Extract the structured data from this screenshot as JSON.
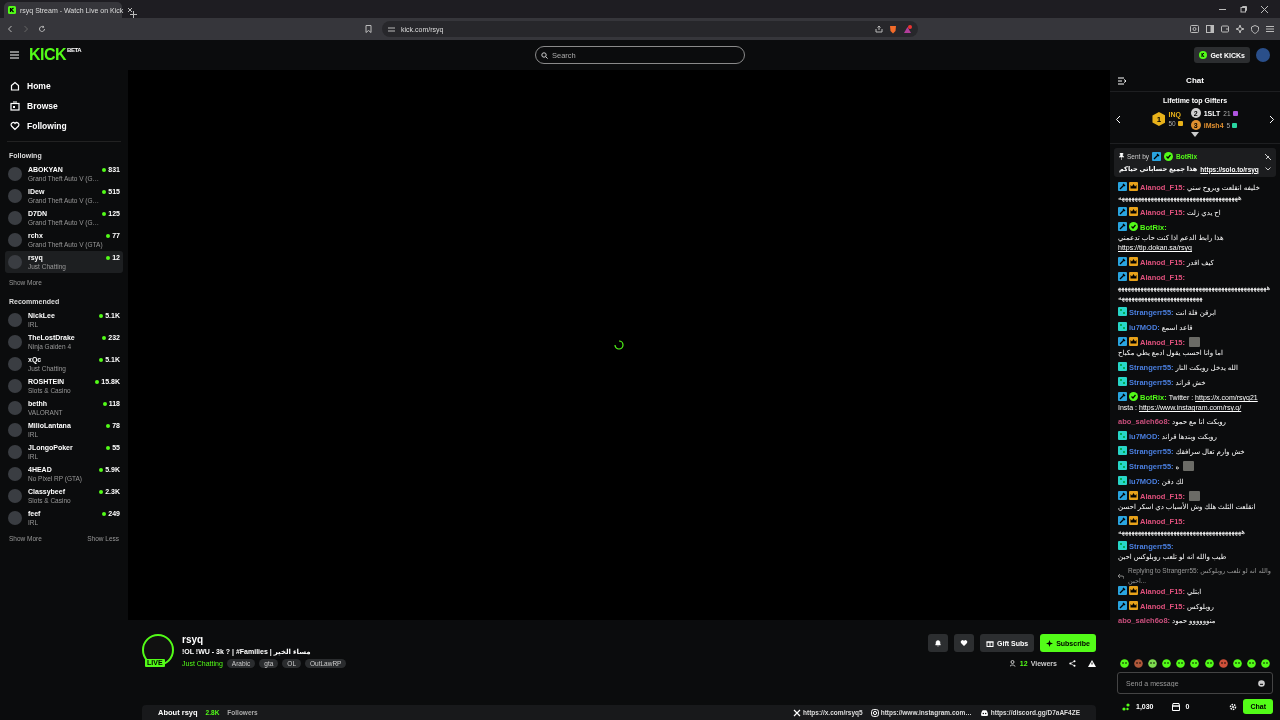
{
  "browser": {
    "tab_title": "rsyq Stream - Watch Live on Kick",
    "url": "kick.com/rsyq"
  },
  "header": {
    "logo": "KICK",
    "logo_badge": "BETA",
    "search": {
      "placeholder": "Search"
    },
    "get_kicks": "Get KICKs"
  },
  "sidebar": {
    "nav": [
      {
        "label": "Home"
      },
      {
        "label": "Browse"
      },
      {
        "label": "Following"
      }
    ],
    "following_title": "Following",
    "following": [
      {
        "name": "ABOKYAN",
        "category": "Grand Theft Auto V (G…",
        "viewers": "831",
        "selected": false
      },
      {
        "name": "lDew",
        "category": "Grand Theft Auto V (G…",
        "viewers": "515",
        "selected": false
      },
      {
        "name": "D7DN",
        "category": "Grand Theft Auto V (G…",
        "viewers": "125",
        "selected": false
      },
      {
        "name": "rchx",
        "category": "Grand Theft Auto V (GTA)",
        "viewers": "77",
        "selected": false
      },
      {
        "name": "rsyq",
        "category": "Just Chatting",
        "viewers": "12",
        "selected": true
      }
    ],
    "following_more": "Show More",
    "recommended_title": "Recommended",
    "recommended": [
      {
        "name": "NickLee",
        "category": "IRL",
        "viewers": "5.1K"
      },
      {
        "name": "TheLostDrake",
        "category": "Ninja Gaiden 4",
        "viewers": "232"
      },
      {
        "name": "xQc",
        "category": "Just Chatting",
        "viewers": "5.1K"
      },
      {
        "name": "ROSHTEIN",
        "category": "Slots & Casino",
        "viewers": "15.8K"
      },
      {
        "name": "bethh",
        "category": "VALORANT",
        "viewers": "118"
      },
      {
        "name": "MilioLantana",
        "category": "IRL",
        "viewers": "78"
      },
      {
        "name": "JLongoPoker",
        "category": "IRL",
        "viewers": "55"
      },
      {
        "name": "4HEAD",
        "category": "No Pixel RP (GTA)",
        "viewers": "5.9K"
      },
      {
        "name": "Classybeef",
        "category": "Slots & Casino",
        "viewers": "2.3K"
      },
      {
        "name": "feef",
        "category": "IRL",
        "viewers": "249"
      }
    ],
    "show_more": "Show More",
    "show_less": "Show Less"
  },
  "stream": {
    "channel": "rsyq",
    "live": "LIVE",
    "title": "!OL !WU - 3k ? | #Families | مساء الخير",
    "category": "Just Chatting",
    "tags": [
      "Arabic",
      "gta",
      "OL",
      "OutLawRP"
    ],
    "gift_subs": "Gift Subs",
    "subscribe": "Subscribe",
    "viewers_count": "12",
    "viewers_label": "Viewers",
    "about": "About rsyq",
    "followers_count": "2.8K",
    "followers_label": "Followers",
    "links": [
      {
        "kind": "x",
        "text": "https://x.com/rsyq5"
      },
      {
        "kind": "instagram",
        "text": "https://www.instagram.com…"
      },
      {
        "kind": "discord",
        "text": "https://discord.gg/D7aAF4ZE"
      }
    ]
  },
  "chat": {
    "title": "Chat",
    "gifters_title": "Lifetime top Gifters",
    "gifters": [
      {
        "rank": "1",
        "name": "INQ",
        "count": "50"
      },
      {
        "rank": "2",
        "name": "1SLT",
        "count": "21"
      },
      {
        "rank": "3",
        "name": "iMsh4",
        "count": "5"
      }
    ],
    "pinned": {
      "sent_by": "Sent by",
      "user": "BotRix",
      "text": "هذا جميع حساباتي حياكم",
      "link": "https://solo.to/rsyq"
    },
    "messages": [
      {
        "user": "Alanod_F15:",
        "color": "#e0517d",
        "kind": "moderator",
        "parts": [
          {
            "kind": "text",
            "text": "خليفه انقلعت ويروح سني"
          },
          {
            "kind": "text",
            "text": "هههههههههههههههههههههههههههههههههههههه"
          }
        ]
      },
      {
        "user": "Alanod_F15:",
        "color": "#e0517d",
        "kind": "moderator",
        "parts": [
          {
            "kind": "text",
            "text": "اح يدي زلت"
          }
        ]
      },
      {
        "user": "BotRix:",
        "color": "#53fc18",
        "kind": "bot",
        "parts": [
          {
            "kind": "text",
            "text": "هذا رابط الدعم اذا كنت حاب تدعمني"
          },
          {
            "kind": "link",
            "text": "https://tip.dokan.sa/rsyq"
          }
        ]
      },
      {
        "user": "Alanod_F15:",
        "color": "#e0517d",
        "kind": "moderator",
        "parts": [
          {
            "kind": "text",
            "text": "كيف اقدر"
          }
        ]
      },
      {
        "user": "Alanod_F15:",
        "color": "#e0517d",
        "kind": "moderator",
        "parts": [
          {
            "kind": "text",
            "text": "ههههههههههههههههههههههههههههههههههههههههههههههههههههههههههههههههههههههههه"
          }
        ]
      },
      {
        "user": "Strangerr55:",
        "color": "#4a7fe0",
        "kind": "subscriber",
        "parts": [
          {
            "kind": "text",
            "text": "ابرقن فلة انت"
          }
        ]
      },
      {
        "user": "iu7MOD:",
        "color": "#4a7fe0",
        "kind": "subscriber",
        "parts": [
          {
            "kind": "text",
            "text": "قاعد اسمع"
          }
        ]
      },
      {
        "user": "Alanod_F15:",
        "color": "#e0517d",
        "kind": "moderator",
        "parts": [
          {
            "kind": "emote"
          },
          {
            "kind": "text",
            "text": "اما وانا احسب يقول ادمع يطي مكباح"
          }
        ]
      },
      {
        "user": "Strangerr55:",
        "color": "#4a7fe0",
        "kind": "subscriber",
        "parts": [
          {
            "kind": "text",
            "text": "الله يدخل روبكت النار"
          }
        ]
      },
      {
        "user": "Strangerr55:",
        "color": "#4a7fe0",
        "kind": "subscriber",
        "parts": [
          {
            "kind": "text",
            "text": "خش قراند"
          }
        ]
      },
      {
        "user": "BotRix:",
        "color": "#53fc18",
        "kind": "bot",
        "parts": [
          {
            "kind": "text",
            "text": "Twitter :"
          },
          {
            "kind": "link",
            "text": "https://x.com/rsyq21"
          },
          {
            "kind": "text",
            "text": "Insta :"
          },
          {
            "kind": "link",
            "text": "https://www.instagram.com/rsy.q/"
          }
        ]
      },
      {
        "user": "abo_saleh6o8:",
        "color": "#c94f7c",
        "kind": "viewer",
        "parts": [
          {
            "kind": "text",
            "text": "روبكت انا مع حمود"
          }
        ]
      },
      {
        "user": "iu7MOD:",
        "color": "#4a7fe0",
        "kind": "subscriber",
        "parts": [
          {
            "kind": "text",
            "text": "روبكت وبندها قراند"
          }
        ]
      },
      {
        "user": "Strangerr55:",
        "color": "#4a7fe0",
        "kind": "subscriber",
        "parts": [
          {
            "kind": "text",
            "text": "خش وارم تعال سرافقك"
          }
        ]
      },
      {
        "user": "Strangerr55:",
        "color": "#4a7fe0",
        "kind": "subscriber",
        "parts": [
          {
            "kind": "text",
            "text": "ه"
          },
          {
            "kind": "emote"
          }
        ]
      },
      {
        "user": "iu7MOD:",
        "color": "#4a7fe0",
        "kind": "subscriber",
        "parts": [
          {
            "kind": "text",
            "text": "لك دفن"
          }
        ]
      },
      {
        "user": "Alanod_F15:",
        "color": "#e0517d",
        "kind": "moderator",
        "parts": [
          {
            "kind": "emote"
          },
          {
            "kind": "text",
            "text": "انقلعت الثلث هلك وش الأسباب دي اسكر احسن"
          }
        ]
      },
      {
        "user": "Alanod_F15:",
        "color": "#e0517d",
        "kind": "moderator",
        "parts": [
          {
            "kind": "text",
            "text": "ههههههههههههههههههههههههههههههههههههههه"
          }
        ]
      },
      {
        "user": "Strangerr55:",
        "color": "#4a7fe0",
        "kind": "subscriber",
        "parts": [
          {
            "kind": "text",
            "text": "طيب والله انه لو تلعب روبلوكس احبن"
          }
        ]
      },
      {
        "user": "Alanod_F15:",
        "color": "#e0517d",
        "kind": "moderator",
        "reply": "Replying to Strangerr55: والله انه لو تلعب روبلوكس احبن...",
        "parts": [
          {
            "kind": "text",
            "text": "ابتلي"
          }
        ]
      },
      {
        "user": "Alanod_F15:",
        "color": "#e0517d",
        "kind": "moderator",
        "parts": [
          {
            "kind": "text",
            "text": "روبلوكس"
          }
        ]
      },
      {
        "user": "abo_saleh6o8:",
        "color": "#c94f7c",
        "kind": "viewer",
        "parts": [
          {
            "kind": "text",
            "text": "منوووووو حمود"
          }
        ]
      }
    ],
    "input": {
      "placeholder": "Send a message"
    },
    "points": "1,030",
    "store_count": "0",
    "send": "Chat"
  }
}
